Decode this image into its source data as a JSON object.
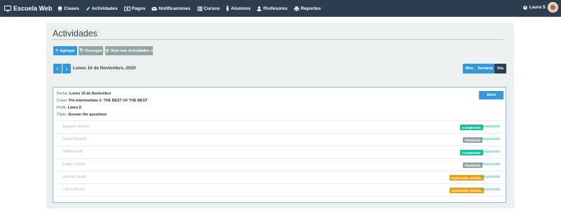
{
  "brand": {
    "name": "Escuela Web"
  },
  "nav": [
    {
      "label": "Clases",
      "icon": "book-icon"
    },
    {
      "label": "Actividades",
      "icon": "pencil-icon"
    },
    {
      "label": "Pagos",
      "icon": "money-icon"
    },
    {
      "label": "Notificaciones",
      "icon": "envelope-icon"
    },
    {
      "label": "Cursos",
      "icon": "list-icon"
    },
    {
      "label": "Alumnos",
      "icon": "male-icon"
    },
    {
      "label": "Profesores",
      "icon": "user-icon"
    },
    {
      "label": "Reportes",
      "icon": "print-icon"
    }
  ],
  "user": {
    "name": "Laura S"
  },
  "page": {
    "title": "Actividades"
  },
  "toolbar": {
    "add_label": "Agregar",
    "reload_label": "Recargar",
    "filter_label": "Sólo mis actividades"
  },
  "date": {
    "label": "Lunes 16 de Noviembre, 2020"
  },
  "views": {
    "month": "Mes",
    "week": "Semana",
    "day": "Día",
    "active": "Día"
  },
  "activity": {
    "fecha_label": "Fecha:",
    "fecha": "Lunes 16 de Noviembre",
    "curso_label": "Curso:",
    "curso": "Pre-intermediate 2- THE BEST OF THE BEST",
    "profe_label": "Profe:",
    "profe": "Laura S",
    "titulo_label": "Título:",
    "titulo": "Answer the questions",
    "open_label": "Abrir"
  },
  "students": [
    {
      "name": "Augusto Ventura",
      "status": "Completado",
      "status_color": "#18bc9c",
      "link": "Respuesta"
    },
    {
      "name": "Daniel Benpelt",
      "status": "Pendiente",
      "status_color": "#95a5a6",
      "link": "Respuesta"
    },
    {
      "name": "Delfina Abril",
      "status": "Completado",
      "status_color": "#18bc9c",
      "link": "Respuesta"
    },
    {
      "name": "Felipe Galván",
      "status": "Pendiente",
      "status_color": "#95a5a6",
      "link": "Respuesta"
    },
    {
      "name": "Ignacio Davilá",
      "status": "Esperando revisión",
      "status_color": "#f39c12",
      "link": "Respuesta"
    },
    {
      "name": "Leticia Muriáz",
      "status": "Esperando revisión",
      "status_color": "#f39c12",
      "link": "Respuesta"
    }
  ],
  "colors": {
    "navbar": "#2c3e50",
    "primary": "#3498db",
    "success": "#18bc9c",
    "warning": "#f39c12",
    "muted": "#95a5a6"
  }
}
